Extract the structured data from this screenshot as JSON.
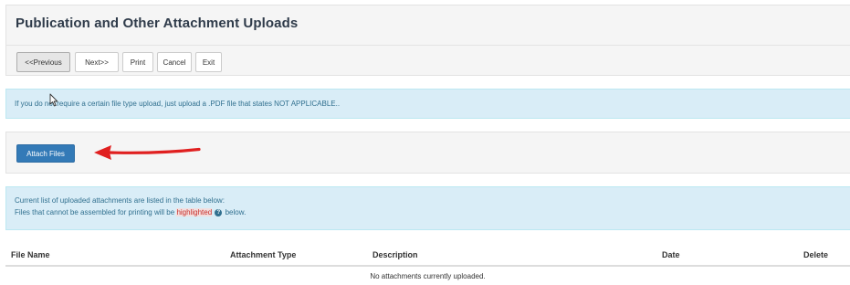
{
  "header": {
    "title": "Publication and Other Attachment Uploads"
  },
  "toolbar": {
    "previous_label": "<<Previous",
    "next_label": "Next>>",
    "print_label": "Print",
    "cancel_label": "Cancel",
    "exit_label": "Exit"
  },
  "notice": {
    "text": "If you do not require a certain file type upload, just upload a .PDF file that states NOT APPLICABLE.."
  },
  "attach": {
    "button_label": "Attach Files"
  },
  "info": {
    "line1": "Current list of uploaded attachments are listed in the table below:",
    "line2_before": "Files that cannot be assembled for printing will be",
    "line2_highlight": "highlighted",
    "line2_after": "below.",
    "help_icon": "question-circle-icon"
  },
  "table": {
    "headers": [
      "File Name",
      "Attachment Type",
      "Description",
      "Date",
      "Delete"
    ],
    "empty_message": "No attachments currently uploaded."
  },
  "colors": {
    "primary": "#337ab7",
    "info_bg": "#d9edf7",
    "arrow": "#e02020"
  }
}
